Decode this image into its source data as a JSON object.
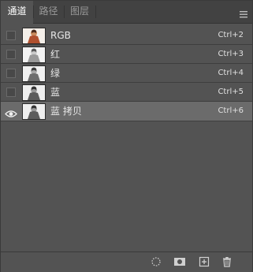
{
  "tabs": [
    {
      "label": "通道",
      "active": true
    },
    {
      "label": "路径",
      "active": false
    },
    {
      "label": "图层",
      "active": false
    }
  ],
  "channels": [
    {
      "name": "RGB",
      "shortcut": "Ctrl+2",
      "visible": false,
      "selected": false,
      "thumb": "color"
    },
    {
      "name": "红",
      "shortcut": "Ctrl+3",
      "visible": false,
      "selected": false,
      "thumb": "gray"
    },
    {
      "name": "绿",
      "shortcut": "Ctrl+4",
      "visible": false,
      "selected": false,
      "thumb": "gray"
    },
    {
      "name": "蓝",
      "shortcut": "Ctrl+5",
      "visible": false,
      "selected": false,
      "thumb": "gray"
    },
    {
      "name": "蓝 拷贝",
      "shortcut": "Ctrl+6",
      "visible": true,
      "selected": true,
      "thumb": "gray"
    }
  ],
  "toolbar": {
    "icons": [
      "load-selection-icon",
      "save-selection-mask-icon",
      "new-channel-icon",
      "delete-channel-icon"
    ]
  },
  "colors": {
    "panel_bg": "#535353",
    "tabbar_bg": "#424242",
    "selected_row_bg": "#6b6b6b"
  }
}
